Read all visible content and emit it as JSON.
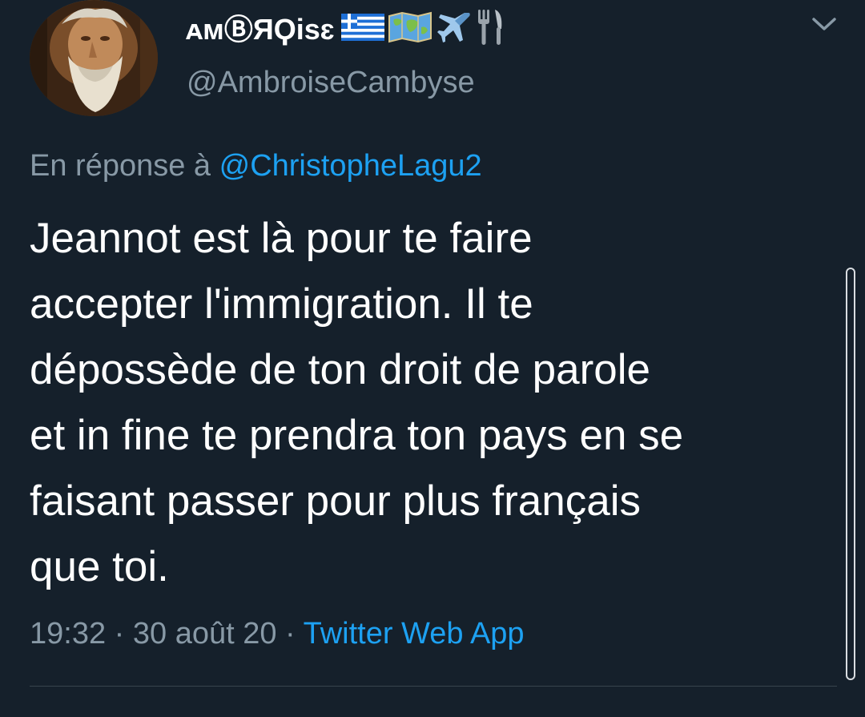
{
  "tweet": {
    "display_name": "ᴀᴍⒷЯϘisɛ",
    "name_icons": [
      "greece-flag-icon",
      "world-map-icon",
      "airplane-icon",
      "fork-knife-icon"
    ],
    "handle": "@AmbroiseCambyse",
    "reply_prefix": "En réponse à",
    "reply_to": "@ChristopheLagu2",
    "text": "Jeannot est là pour te faire\naccepter l'immigration. Il te\ndépossède de ton droit de parole\net in fine te prendra ton pays en se\nfaisant passer pour plus français\nque toi.",
    "time_date": "19:32 · 30 août 20",
    "separator": "·",
    "source": "Twitter Web App"
  },
  "colors": {
    "background": "#15202b",
    "text_primary": "#ffffff",
    "text_secondary": "#8899a6",
    "accent": "#1da1f2",
    "divider": "#38444d"
  },
  "icons": {
    "menu_toggle": "chevron-down-icon"
  }
}
